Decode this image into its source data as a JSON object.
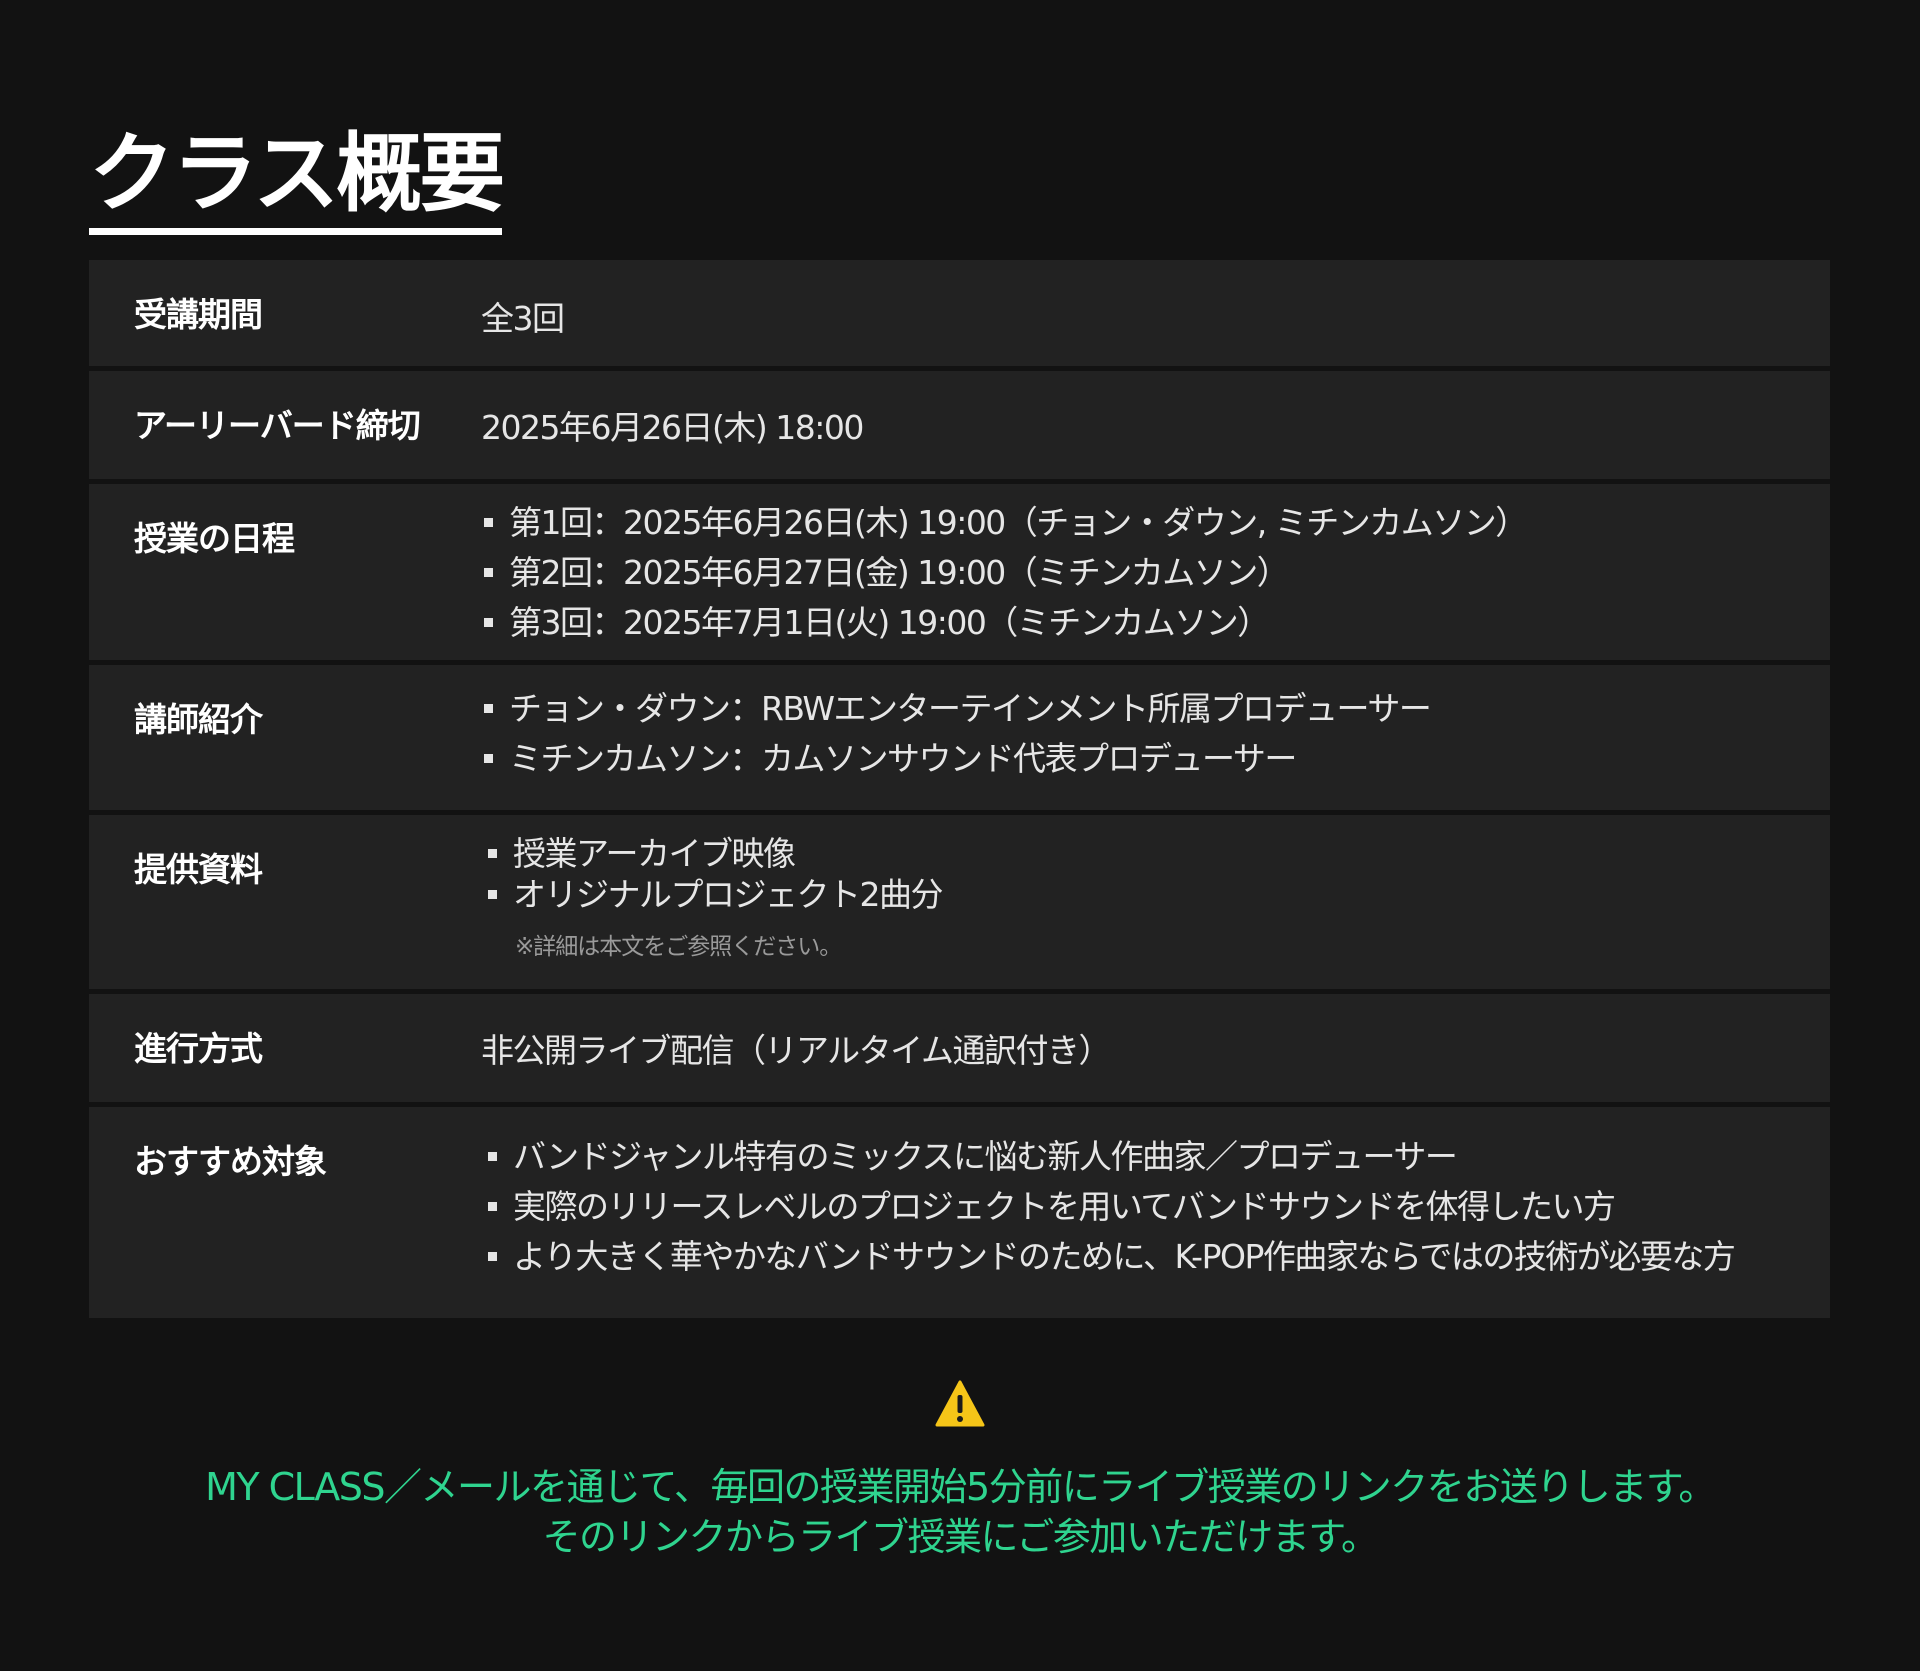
{
  "title": "クラス概要",
  "rows": {
    "period": {
      "label": "受講期間",
      "value": "全3回"
    },
    "early_bird": {
      "label": "アーリーバード締切",
      "value": "2025年6月26日(木) 18:00"
    },
    "schedule": {
      "label": "授業の日程",
      "items": [
        "第1回：2025年6月26日(木) 19:00（チョン・ダウン, ミチンカムソン）",
        "第2回：2025年6月27日(金) 19:00（ミチンカムソン）",
        "第3回：2025年7月1日(火) 19:00（ミチンカムソン）"
      ]
    },
    "instructors": {
      "label": "講師紹介",
      "items": [
        "チョン・ダウン：RBWエンターテインメント所属プロデューサー",
        "ミチンカムソン：カムソンサウンド代表プロデューサー"
      ]
    },
    "materials": {
      "label": "提供資料",
      "items": [
        "授業アーカイブ映像",
        "オリジナルプロジェクト2曲分"
      ],
      "note": "※詳細は本文をご参照ください。"
    },
    "format": {
      "label": "進行方式",
      "value": "非公開ライブ配信（リアルタイム通訳付き）"
    },
    "target": {
      "label": "おすすめ対象",
      "items": [
        "バンドジャンル特有のミックスに悩む新人作曲家／プロデューサー",
        "実際のリリースレベルのプロジェクトを用いてバンドサウンドを体得したい方",
        "より大きく華やかなバンドサウンドのために、K-POP作曲家ならではの技術が必要な方"
      ]
    }
  },
  "notice": {
    "icon": "warning-icon",
    "line1": "MY CLASS／メールを通じて、毎回の授業開始5分前にライブ授業のリンクをお送りします。",
    "line2": "そのリンクからライブ授業にご参加いただけます。"
  },
  "colors": {
    "background": "#121212",
    "row_background": "#222222",
    "accent_green": "#2fd48f",
    "warning_yellow": "#f5c518"
  }
}
